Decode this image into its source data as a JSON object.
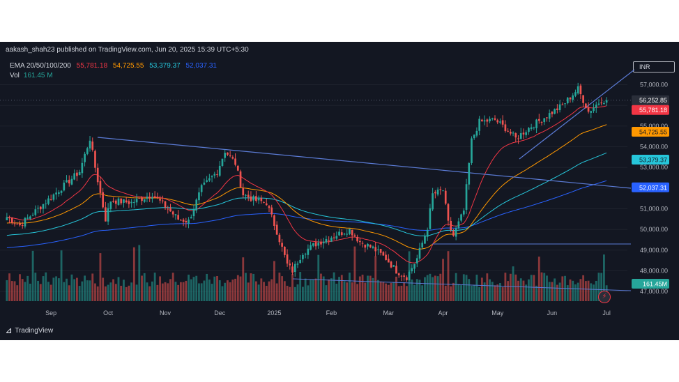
{
  "header": {
    "publisher": "aakash_shah23 published on TradingView.com, Jun 20, 2025 15:39 UTC+5:30"
  },
  "legend": {
    "ema_label": "EMA 20/50/100/200",
    "ema20": "55,781.18",
    "ema50": "54,725.55",
    "ema100": "53,379.37",
    "ema200": "52,037.31",
    "vol_label": "Vol",
    "vol_value": "161.45 M"
  },
  "currency": "INR",
  "brand": "TradingView",
  "colors": {
    "bg": "#131722",
    "up": "#26a69a",
    "down": "#ef5350",
    "ema20": "#f23645",
    "ema50": "#ff9800",
    "ema100": "#26c6da",
    "ema200": "#2962ff",
    "trendline": "#5b7bd5"
  },
  "chart_data": {
    "type": "candlestick",
    "x_axis_labels": [
      "Sep",
      "Oct",
      "Nov",
      "Dec",
      "2025",
      "Feb",
      "Mar",
      "Apr",
      "May",
      "Jun",
      "Jul"
    ],
    "y_axis_ticks": [
      47000,
      48000,
      49000,
      50000,
      51000,
      52000,
      53000,
      54000,
      55000,
      56000,
      57000
    ],
    "y_axis_tick_labels": [
      "47,000.00",
      "48,000.00",
      "49,000.00",
      "50,000.00",
      "51,000.00",
      "52,000.00",
      "53,000.00",
      "54,000.00",
      "55,000.00",
      "56,000.00",
      "57,000.00"
    ],
    "ylim": [
      46400,
      58400
    ],
    "price_labels": [
      {
        "name": "last-price",
        "value": 56252.85,
        "text": "56,252.85",
        "color": "#2a2e39"
      },
      {
        "name": "ema20",
        "value": 55781.18,
        "text": "55,781.18",
        "color": "#f23645"
      },
      {
        "name": "ema50",
        "value": 54725.55,
        "text": "54,725.55",
        "color": "#ff9800"
      },
      {
        "name": "ema100",
        "value": 53379.37,
        "text": "53,379.37",
        "color": "#26c6da"
      },
      {
        "name": "ema200",
        "value": 52037.31,
        "text": "52,037.31",
        "color": "#2962ff"
      }
    ],
    "volume_label": {
      "text": "161.45M",
      "color": "#26a69a"
    },
    "waypoints": [
      [
        0,
        50600
      ],
      [
        5,
        50200
      ],
      [
        12,
        51000
      ],
      [
        20,
        51900
      ],
      [
        28,
        52800
      ],
      [
        32,
        54400
      ],
      [
        34,
        53000
      ],
      [
        38,
        50500
      ],
      [
        40,
        51400
      ],
      [
        48,
        51300
      ],
      [
        56,
        51700
      ],
      [
        62,
        51000
      ],
      [
        66,
        50500
      ],
      [
        70,
        50400
      ],
      [
        75,
        52000
      ],
      [
        81,
        52800
      ],
      [
        84,
        53800
      ],
      [
        88,
        53200
      ],
      [
        91,
        51700
      ],
      [
        96,
        51400
      ],
      [
        100,
        51300
      ],
      [
        104,
        49900
      ],
      [
        108,
        48300
      ],
      [
        110,
        48000
      ],
      [
        114,
        48900
      ],
      [
        119,
        49300
      ],
      [
        124,
        49600
      ],
      [
        128,
        49800
      ],
      [
        132,
        50000
      ],
      [
        136,
        49400
      ],
      [
        141,
        49100
      ],
      [
        146,
        48600
      ],
      [
        150,
        48000
      ],
      [
        154,
        47700
      ],
      [
        158,
        48600
      ],
      [
        162,
        50100
      ],
      [
        164,
        51700
      ],
      [
        168,
        51900
      ],
      [
        170,
        50300
      ],
      [
        172,
        49700
      ],
      [
        176,
        50900
      ],
      [
        179,
        54300
      ],
      [
        182,
        55200
      ],
      [
        188,
        55300
      ],
      [
        192,
        54900
      ],
      [
        196,
        54400
      ],
      [
        202,
        55000
      ],
      [
        208,
        55500
      ],
      [
        214,
        56000
      ],
      [
        220,
        56800
      ],
      [
        224,
        55700
      ],
      [
        229,
        56252
      ]
    ],
    "x_label_indices": [
      17,
      39,
      61,
      82,
      103,
      125,
      147,
      168,
      189,
      210,
      231
    ],
    "total_bars": 232
  }
}
